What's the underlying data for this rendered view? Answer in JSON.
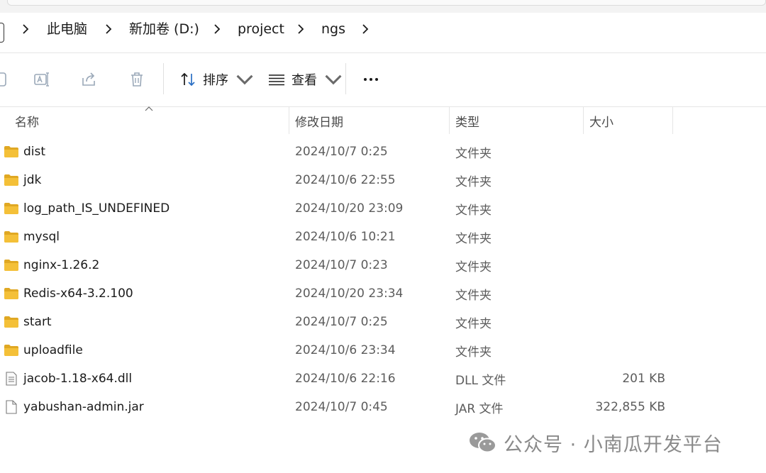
{
  "breadcrumb": {
    "items": [
      "此电脑",
      "新加卷 (D:)",
      "project",
      "ngs"
    ]
  },
  "toolbar": {
    "sort_label": "排序",
    "view_label": "查看",
    "icons": [
      "rename-icon",
      "share-icon",
      "delete-icon",
      "sort-icon",
      "view-icon",
      "more-icon"
    ]
  },
  "columns": {
    "name": "名称",
    "date": "修改日期",
    "type": "类型",
    "size": "大小"
  },
  "files": [
    {
      "name": "dist",
      "date": "2024/10/7 0:25",
      "type": "文件夹",
      "size": "",
      "icon": "folder-icon"
    },
    {
      "name": "jdk",
      "date": "2024/10/6 22:55",
      "type": "文件夹",
      "size": "",
      "icon": "folder-icon"
    },
    {
      "name": "log_path_IS_UNDEFINED",
      "date": "2024/10/20 23:09",
      "type": "文件夹",
      "size": "",
      "icon": "folder-icon"
    },
    {
      "name": "mysql",
      "date": "2024/10/6 10:21",
      "type": "文件夹",
      "size": "",
      "icon": "folder-icon"
    },
    {
      "name": "nginx-1.26.2",
      "date": "2024/10/7 0:23",
      "type": "文件夹",
      "size": "",
      "icon": "folder-icon"
    },
    {
      "name": "Redis-x64-3.2.100",
      "date": "2024/10/20 23:34",
      "type": "文件夹",
      "size": "",
      "icon": "folder-icon"
    },
    {
      "name": "start",
      "date": "2024/10/7 0:25",
      "type": "文件夹",
      "size": "",
      "icon": "folder-icon"
    },
    {
      "name": "uploadfile",
      "date": "2024/10/6 23:34",
      "type": "文件夹",
      "size": "",
      "icon": "folder-icon"
    },
    {
      "name": "jacob-1.18-x64.dll",
      "date": "2024/10/6 22:16",
      "type": "DLL 文件",
      "size": "201 KB",
      "icon": "dll-file-icon"
    },
    {
      "name": "yabushan-admin.jar",
      "date": "2024/10/7 0:45",
      "type": "JAR 文件",
      "size": "322,855 KB",
      "icon": "file-icon"
    }
  ],
  "watermark": {
    "text": "公众号 · 小南瓜开发平台"
  },
  "colors": {
    "folder": "#f4c038",
    "folder_dark": "#e0a823",
    "text": "#1a1a1a",
    "muted": "#5c5c5c"
  }
}
